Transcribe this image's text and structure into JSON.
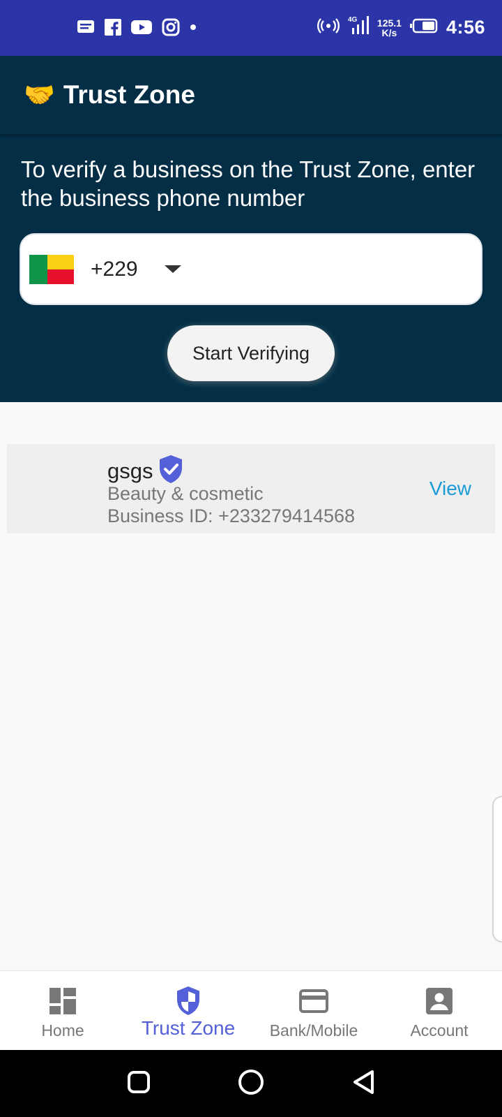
{
  "status_bar": {
    "notification_icons": [
      "message-icon",
      "facebook-icon",
      "youtube-icon",
      "instagram-icon",
      "dot-icon"
    ],
    "network_type": "4G",
    "net_speed_value": "125.1",
    "net_speed_unit": "K/s",
    "time": "4:56"
  },
  "app_bar": {
    "logo_icon": "handshake-icon",
    "title": "Trust Zone"
  },
  "verify": {
    "instruction": "To verify a business on the Trust Zone, enter the business phone number",
    "country_code": "+229",
    "country_flag": "benin-flag",
    "phone_value": "",
    "start_button": "Start Verifying"
  },
  "businesses": [
    {
      "name": "gsgs",
      "verified": true,
      "category": "Beauty & cosmetic",
      "business_id": "Business ID: +233279414568",
      "action": "View"
    }
  ],
  "bottom_nav": {
    "items": [
      {
        "label": "Home",
        "icon": "dashboard-icon",
        "active": false
      },
      {
        "label": "Trust Zone",
        "icon": "shield-icon",
        "active": true
      },
      {
        "label": "Bank/Mobile",
        "icon": "credit-card-icon",
        "active": false
      },
      {
        "label": "Account",
        "icon": "account-box-icon",
        "active": false
      }
    ]
  },
  "colors": {
    "status_bar": "#2b35a7",
    "app_bar": "#032e45",
    "accent": "#5460d8",
    "link": "#1a9ad6"
  }
}
